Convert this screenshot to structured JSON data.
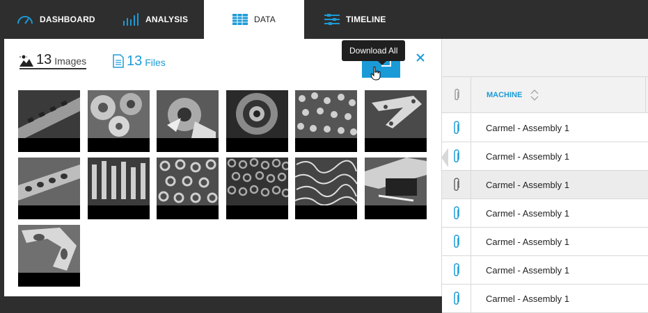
{
  "nav": {
    "items": [
      {
        "label": "DASHBOARD",
        "icon": "gauge-icon"
      },
      {
        "label": "ANALYSIS",
        "icon": "bar-chart-icon"
      },
      {
        "label": "DATA",
        "icon": "table-icon",
        "active": true
      },
      {
        "label": "TIMELINE",
        "icon": "timeline-icon"
      }
    ]
  },
  "panel": {
    "images_tab": {
      "count": "13",
      "label": "Images",
      "icon": "landscape-icon"
    },
    "files_tab": {
      "count": "13",
      "label": "Files",
      "icon": "document-icon"
    },
    "download_tooltip": "Download All",
    "close_icon": "close-icon",
    "thumbnails": [
      "machined-bar",
      "gear-parts",
      "lathe-cutting",
      "gear-ring",
      "bolt-pile",
      "bracket",
      "perforated-bar",
      "fasteners",
      "nuts",
      "nuts-dense",
      "metal-shavings",
      "press-machine",
      "triangular-frame"
    ]
  },
  "table": {
    "column": "MACHINE",
    "rows": [
      {
        "machine": "Carmel - Assembly 1",
        "attached": true
      },
      {
        "machine": "Carmel - Assembly 1",
        "attached": true
      },
      {
        "machine": "Carmel - Assembly 1",
        "attached": false,
        "selected": true
      },
      {
        "machine": "Carmel - Assembly 1",
        "attached": true
      },
      {
        "machine": "Carmel - Assembly 1",
        "attached": true
      },
      {
        "machine": "Carmel - Assembly 1",
        "attached": true
      },
      {
        "machine": "Carmel - Assembly 1",
        "attached": true
      }
    ]
  },
  "colors": {
    "accent": "#1a9bd7",
    "nav_bg": "#2e2e2e",
    "header_bg": "#f2f2f2"
  }
}
